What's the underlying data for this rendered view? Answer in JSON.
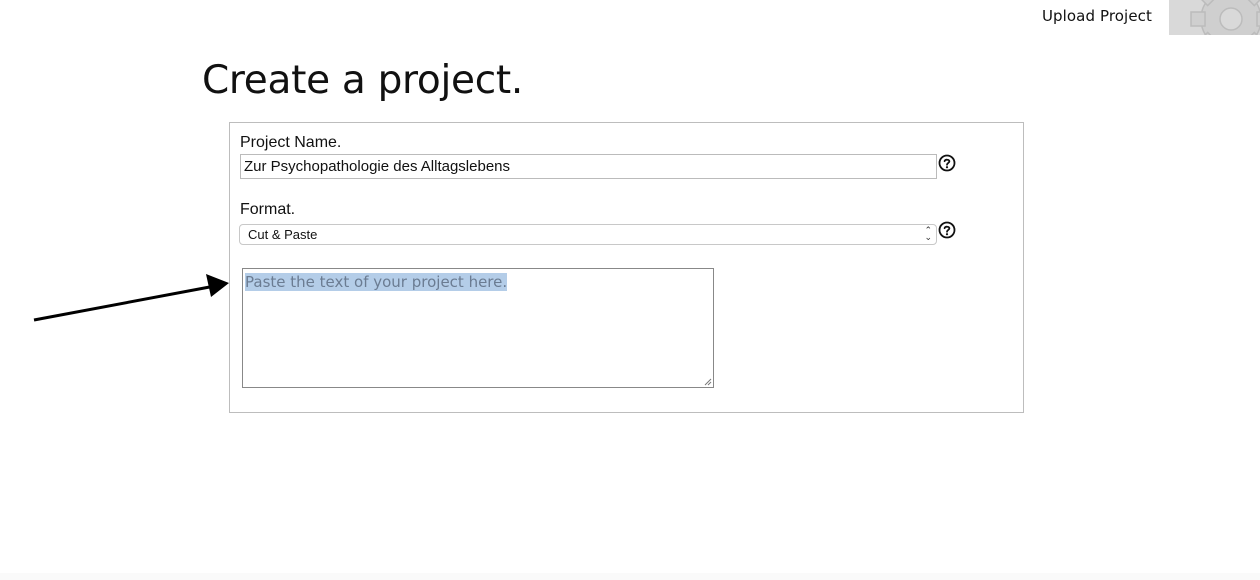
{
  "header": {
    "upload_label": "Upload Project",
    "settings_icon": "gear-icon"
  },
  "page": {
    "title": "Create a project."
  },
  "form": {
    "project_name_label": "Project Name.",
    "project_name_value": "Zur Psychopathologie des Alltagslebens",
    "format_label": "Format.",
    "format_selected": "Cut & Paste",
    "text_placeholder": "Paste the text of your project here.",
    "help_icon": "question-circle-icon"
  },
  "annotation": {
    "arrow_icon": "pointer-arrow",
    "color": "#000000"
  }
}
